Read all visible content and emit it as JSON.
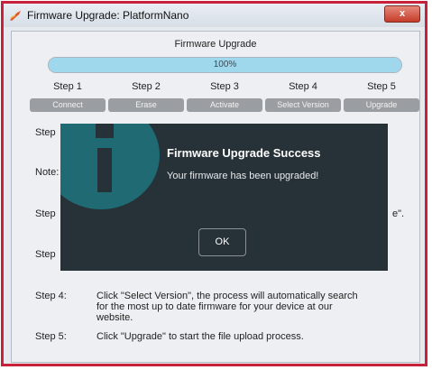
{
  "window": {
    "title": "Firmware Upgrade: PlatformNano",
    "close_glyph": "x",
    "icon": "app-icon"
  },
  "main": {
    "heading": "Firmware Upgrade",
    "progress": {
      "value": 100,
      "label": "100%"
    },
    "steps": [
      {
        "label": "Step 1",
        "button": "Connect"
      },
      {
        "label": "Step 2",
        "button": "Erase"
      },
      {
        "label": "Step 3",
        "button": "Activate"
      },
      {
        "label": "Step 4",
        "button": "Select Version"
      },
      {
        "label": "Step 5",
        "button": "Upgrade"
      }
    ],
    "rows": {
      "row1_label": "Step",
      "note_label": "Note:",
      "row2_label": "Step",
      "row2_tail": "e\".",
      "row3_label": "Step",
      "step4_label": "Step 4:",
      "step4_text": "Click \"Select Version\", the process will automatically search for the most up to date firmware for your device at our website.",
      "step5_label": "Step 5:",
      "step5_text": "Click \"Upgrade\" to start the file upload process."
    }
  },
  "dialog": {
    "title": "Firmware Upgrade Success",
    "message": "Your firmware has been upgraded!",
    "ok_label": "OK",
    "icon": "info-icon",
    "colors": {
      "background": "#263238",
      "circle": "#1f6a73"
    }
  },
  "colors": {
    "accent": "#9fd8ec",
    "window_border": "#c8213a"
  }
}
